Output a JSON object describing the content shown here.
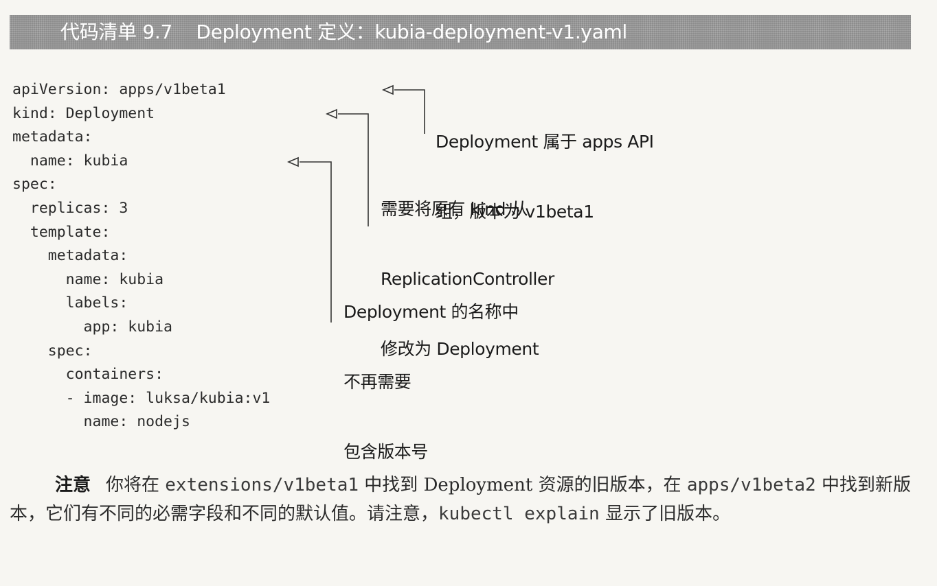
{
  "listing": {
    "title": "代码清单 9.7    Deployment 定义：kubia-deployment-v1.yaml"
  },
  "code_lines": [
    "apiVersion: apps/v1beta1",
    "kind: Deployment",
    "metadata:",
    "  name: kubia",
    "spec:",
    "  replicas: 3",
    "  template:",
    "    metadata:",
    "      name: kubia",
    "      labels:",
    "        app: kubia",
    "    spec:",
    "      containers:",
    "      - image: luksa/kubia:v1",
    "        name: nodejs"
  ],
  "annotations": [
    {
      "lines": [
        "Deployment 属于 apps API",
        "组，版本为 v1beta1"
      ]
    },
    {
      "lines": [
        "需要将原有 kind 从",
        "ReplicationController",
        "修改为 Deployment"
      ]
    },
    {
      "lines": [
        "Deployment 的名称中",
        "不再需要",
        "包含版本号"
      ]
    }
  ],
  "note": {
    "label": "注意",
    "text_1": "你将在 ",
    "code_1": "extensions/v1beta1",
    "text_2": " 中找到 Deployment 资源的旧版本，在 ",
    "code_2": "apps/v1beta2",
    "text_3": " 中找到新版本，它们有不同的必需字段和不同的默认值。请注意，",
    "code_3": "kubectl explain",
    "text_4": " 显示了旧版本。"
  }
}
